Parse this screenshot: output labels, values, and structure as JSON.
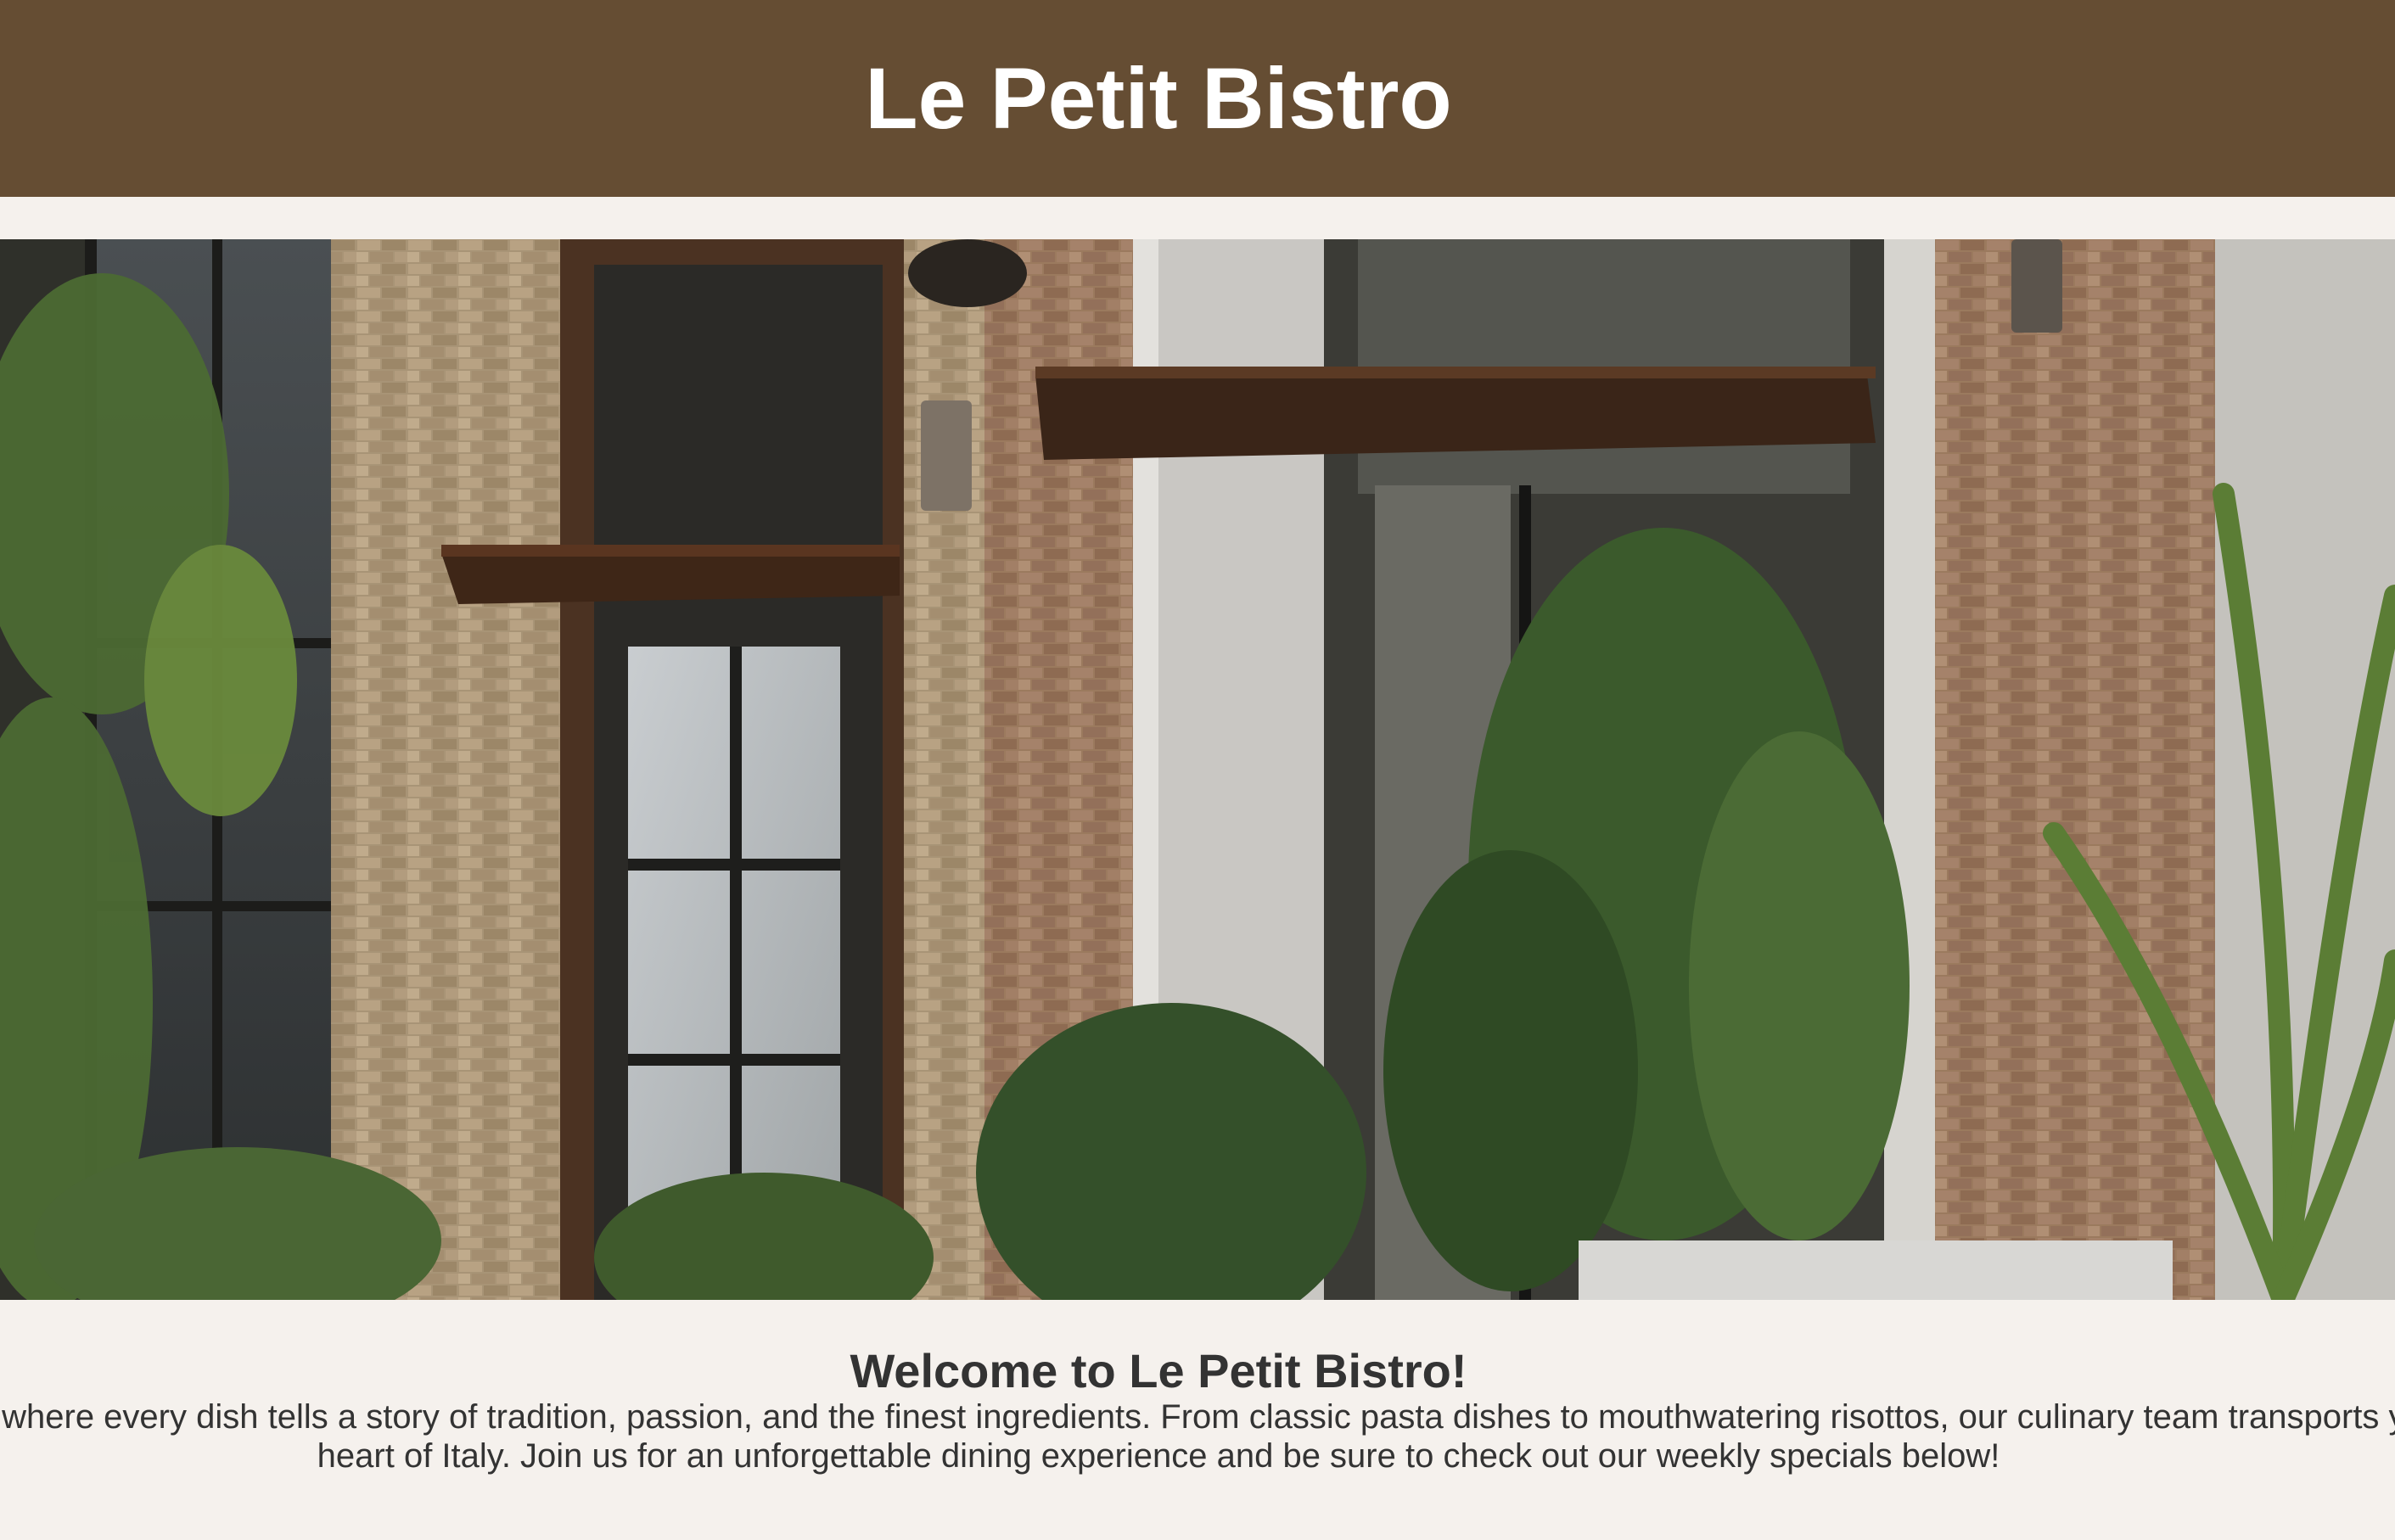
{
  "header": {
    "title": "Le Petit Bistro"
  },
  "hero": {
    "image": "restaurant-storefront-photo"
  },
  "welcome": {
    "heading": "Welcome to Le Petit Bistro!",
    "body": "Discover an authentic Italian gem where every dish tells a story of tradition, passion, and the finest ingredients. From classic pasta dishes to mouthwatering risottos, our culinary team transports your tastebuds straight to the heart of Italy. Join us for an unforgettable dining experience and be sure to check out our weekly specials below!"
  },
  "colors": {
    "header_bg": "#654d33",
    "page_bg": "#f5f1ed",
    "text": "#333333"
  }
}
